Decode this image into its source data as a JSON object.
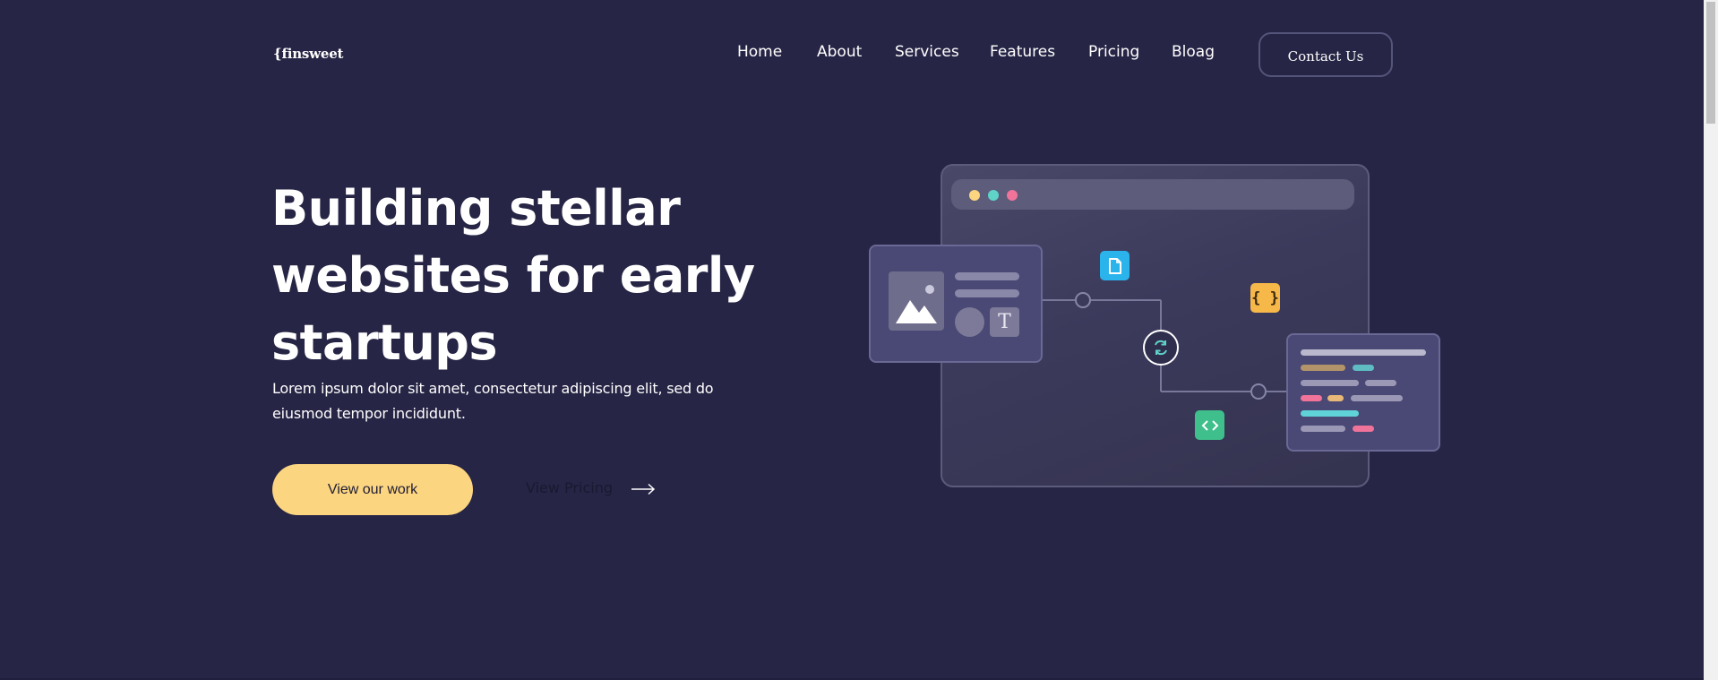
{
  "header": {
    "logo": "{finsweet",
    "nav": [
      "Home",
      "About",
      "Services",
      "Features",
      "Pricing",
      "Bloag"
    ],
    "contact_label": "Contact Us"
  },
  "hero": {
    "title_lines": [
      "Building stellar",
      "websites for early",
      "startups"
    ],
    "description_lines": [
      "Lorem ipsum dolor sit amet, consectetur adipiscing elit, sed do",
      "eiusmod tempor incididunt."
    ],
    "primary_cta": "View our work",
    "secondary_cta": "View Pricing"
  },
  "illustration": {
    "code_badge": "{ }",
    "text_tile": "T",
    "icons": [
      "document-icon",
      "curly-braces-icon",
      "sync-icon",
      "code-icon",
      "image-icon"
    ]
  },
  "colors": {
    "background": "#262545",
    "accent": "#fcd580",
    "teal": "#5fd3c8",
    "pink": "#f0739a",
    "blue": "#2bb3ec",
    "green": "#3fbf8c"
  }
}
